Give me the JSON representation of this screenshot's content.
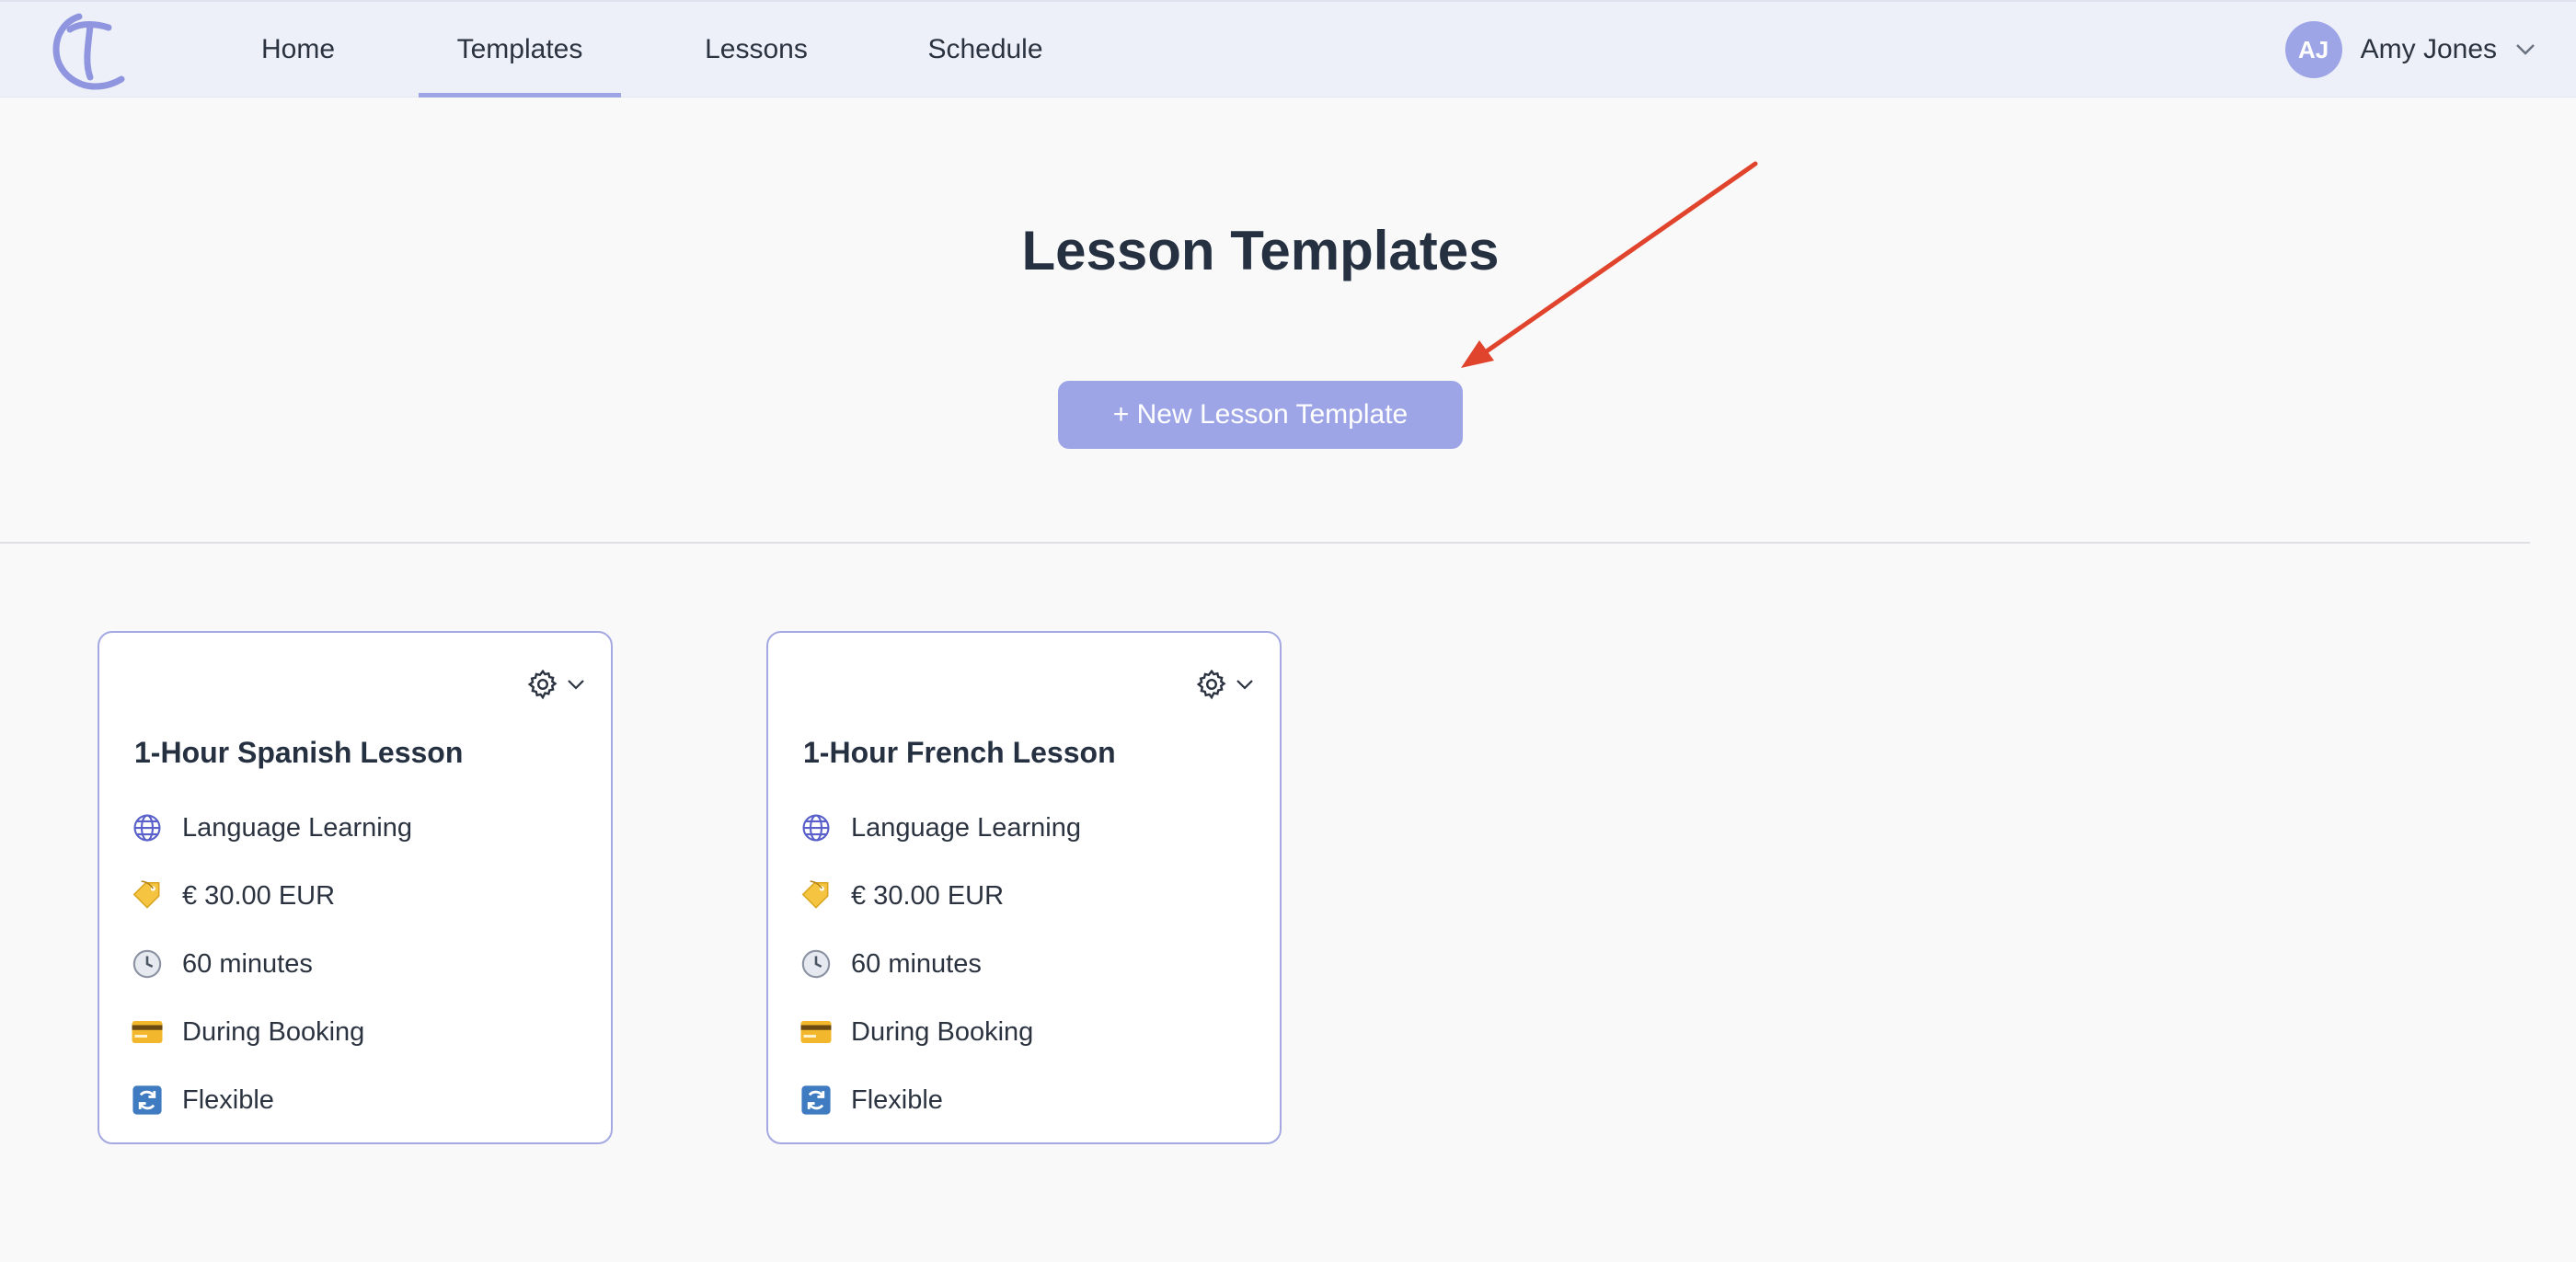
{
  "nav": {
    "items": [
      {
        "label": "Home"
      },
      {
        "label": "Templates",
        "active": true
      },
      {
        "label": "Lessons"
      },
      {
        "label": "Schedule"
      }
    ]
  },
  "user": {
    "initials": "AJ",
    "name": "Amy Jones"
  },
  "page": {
    "title": "Lesson Templates",
    "new_button_label": "+ New Lesson Template"
  },
  "cards": [
    {
      "title": "1-Hour Spanish Lesson",
      "category": "Language Learning",
      "price": "€ 30.00 EUR",
      "duration": "60 minutes",
      "payment": "During Booking",
      "cancellation": "Flexible"
    },
    {
      "title": "1-Hour French Lesson",
      "category": "Language Learning",
      "price": "€ 30.00 EUR",
      "duration": "60 minutes",
      "payment": "During Booking",
      "cancellation": "Flexible"
    }
  ],
  "colors": {
    "accent": "#9ea5e6",
    "annotation_arrow": "#e0442c",
    "card_border": "#a4a9e2"
  }
}
